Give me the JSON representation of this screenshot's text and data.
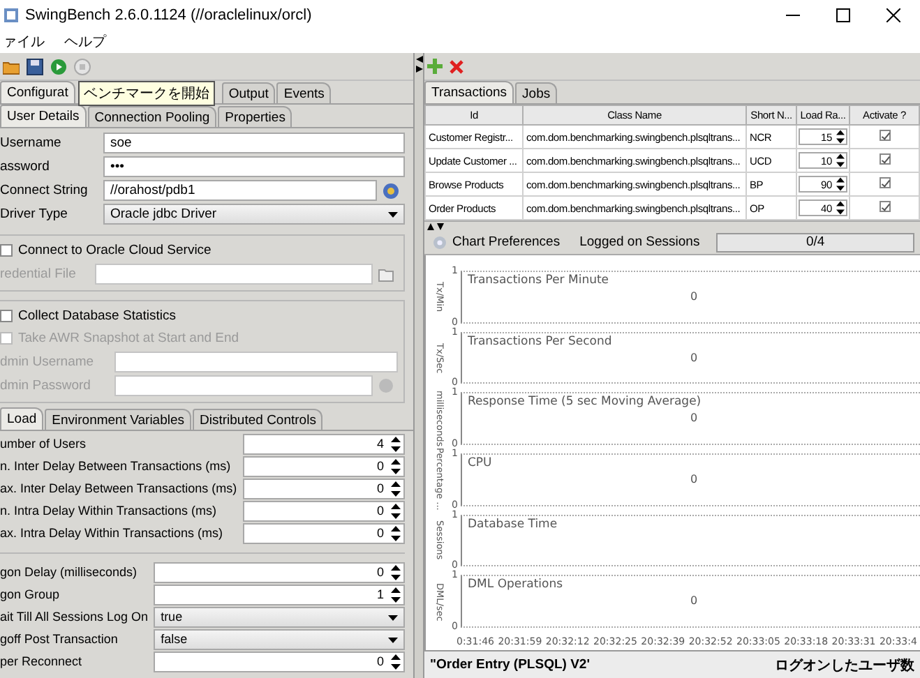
{
  "window": {
    "title": "SwingBench 2.6.0.1124  (//oraclelinux/orcl)"
  },
  "menu": [
    {
      "label": "ァイル"
    },
    {
      "label": "ヘルプ"
    }
  ],
  "tooltip": "ベンチマークを開始",
  "main_tabs": [
    {
      "label": "Configurat",
      "selected": true
    },
    {
      "label": "Output",
      "selected": false
    },
    {
      "label": "Events",
      "selected": false
    }
  ],
  "detail_tabs": [
    {
      "label": "User Details",
      "selected": true
    },
    {
      "label": "Connection Pooling",
      "selected": false
    },
    {
      "label": "Properties",
      "selected": false
    }
  ],
  "connection_fields": [
    {
      "label": "Username",
      "kind": "text",
      "value": "soe"
    },
    {
      "label": "assword",
      "kind": "password",
      "value": "•••"
    },
    {
      "label": "Connect String",
      "kind": "lookup",
      "value": "//orahost/pdb1"
    },
    {
      "label": "Driver Type",
      "kind": "select",
      "value": "Oracle jdbc Driver"
    }
  ],
  "cloud": {
    "label": "Connect to Oracle Cloud Service",
    "checked": false,
    "fields": [
      {
        "label": "redential File",
        "kind": "file",
        "disabled": true
      }
    ]
  },
  "stats": {
    "label": "Collect Database Statistics",
    "checked": false,
    "awr": {
      "label": "Take AWR Snapshot at Start and End",
      "checked": false,
      "disabled": true
    },
    "fields": [
      {
        "label": "dmin Username",
        "kind": "text",
        "disabled": true
      },
      {
        "label": "dmin Password",
        "kind": "lookup",
        "disabled": true
      }
    ]
  },
  "load_tabs": [
    {
      "label": "Load",
      "selected": true
    },
    {
      "label": "Environment Variables",
      "selected": false
    },
    {
      "label": "Distributed Controls",
      "selected": false
    }
  ],
  "load_settings": [
    {
      "label": "umber of Users",
      "kind": "spinner",
      "value": "4"
    },
    {
      "label": "n. Inter Delay Between Transactions (ms)",
      "kind": "spinner",
      "value": "0"
    },
    {
      "label": "ax. Inter Delay Between Transactions (ms)",
      "kind": "spinner",
      "value": "0"
    },
    {
      "label": "n. Intra Delay Within Transactions (ms)",
      "kind": "spinner",
      "value": "0"
    },
    {
      "label": "ax. Intra Delay Within Transactions (ms)",
      "kind": "spinner",
      "value": "0"
    }
  ],
  "logon_settings": [
    {
      "label": "gon Delay (milliseconds)",
      "kind": "spinner",
      "value": "0"
    },
    {
      "label": "gon Group",
      "kind": "spinner",
      "value": "1"
    },
    {
      "label": "ait Till All Sessions Log On",
      "kind": "select",
      "value": "true"
    },
    {
      "label": "goff Post Transaction",
      "kind": "select",
      "value": "false"
    },
    {
      "label": "per Reconnect",
      "kind": "spinner",
      "value": "0"
    }
  ],
  "transaction_tabs": [
    {
      "label": "Transactions",
      "selected": true
    },
    {
      "label": "Jobs",
      "selected": false
    }
  ],
  "table": {
    "columns": [
      "Id",
      "Class Name",
      "Short N...",
      "Load Ra...",
      "Activate ?"
    ],
    "rows": [
      {
        "id": "Customer Registr...",
        "class_name": "com.dom.benchmarking.swingbench.plsqltrans...",
        "short_name": "NCR",
        "load_ratio": "15",
        "active": true
      },
      {
        "id": "Update Customer ...",
        "class_name": "com.dom.benchmarking.swingbench.plsqltrans...",
        "short_name": "UCD",
        "load_ratio": "10",
        "active": true
      },
      {
        "id": "Browse Products",
        "class_name": "com.dom.benchmarking.swingbench.plsqltrans...",
        "short_name": "BP",
        "load_ratio": "90",
        "active": true
      },
      {
        "id": "Order Products",
        "class_name": "com.dom.benchmarking.swingbench.plsqltrans...",
        "short_name": "OP",
        "load_ratio": "40",
        "active": true
      }
    ]
  },
  "chart_preferences": "Chart Preferences",
  "sessions": {
    "label": "Logged on Sessions",
    "reading": "0/4",
    "level": 0
  },
  "charts": [
    {
      "y_label": "Tx/Min",
      "y_max": "1",
      "y_min": "0",
      "title": "Transactions Per Minute",
      "reading": "0"
    },
    {
      "y_label": "Tx/Sec",
      "y_max": "1",
      "y_min": "0",
      "title": "Transactions Per Second",
      "reading": "0"
    },
    {
      "y_label": "milliseconds",
      "y_max": "1",
      "y_min": "0",
      "title": "Response Time (5 sec Moving Average)",
      "reading": "0"
    },
    {
      "y_label": "Percentage ...",
      "y_max": "1",
      "y_min": "0",
      "title": "CPU",
      "reading": "0"
    },
    {
      "y_label": "Sessions",
      "y_max": "1",
      "y_min": "0",
      "title": "Database Time"
    },
    {
      "y_label": "DML/sec",
      "y_max": "1",
      "y_min": "0",
      "title": "DML Operations",
      "reading": "0"
    }
  ],
  "time_axis": [
    "0:31:46",
    "20:31:59",
    "20:32:12",
    "20:32:25",
    "20:32:39",
    "20:32:52",
    "20:33:05",
    "20:33:18",
    "20:33:31",
    "20:33:4"
  ],
  "status_bar": {
    "left": "\"Order Entry (PLSQL) V2'",
    "right": "ログオンしたユーザ数"
  }
}
